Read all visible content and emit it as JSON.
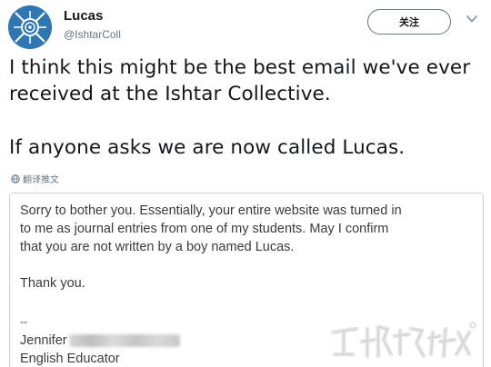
{
  "user": {
    "name": "Lucas",
    "handle": "@IshtarColl"
  },
  "follow_button": {
    "label": "关注"
  },
  "tweet": {
    "paragraphs": [
      "I think this might be the best email we've ever",
      "received at the Ishtar Collective.",
      "If anyone asks we are now called Lucas."
    ]
  },
  "translate": {
    "label": "翻译推文"
  },
  "email": {
    "body_lines": [
      "Sorry to bother you. Essentially, your entire website was turned in",
      "to me as journal entries from one of my students. May I confirm",
      "that you are not written by a boy named Lucas."
    ],
    "thanks": "Thank you.",
    "signature_dash": "--",
    "signature_name": "Jennifer",
    "signature_title": "English Educator"
  },
  "icons": {
    "avatar": "ishtar-logo",
    "caret": "chevron-down-icon",
    "globe": "globe-icon"
  },
  "colors": {
    "avatar_bg": "#2f77b3",
    "text": "#14171a",
    "secondary": "#657786",
    "border": "#c7d0d7"
  }
}
